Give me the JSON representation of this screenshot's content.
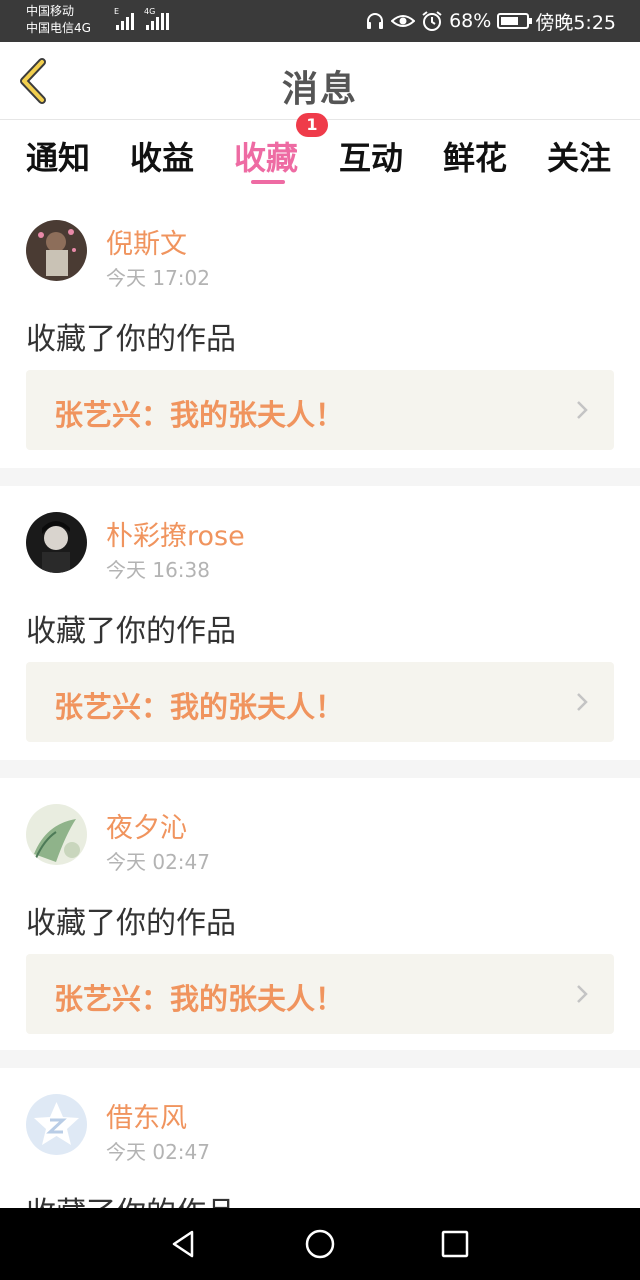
{
  "status_bar": {
    "carrier_1": "中国移动",
    "carrier_2": "中国电信4G",
    "signal_1_label": "E",
    "signal_2_label": "4G",
    "battery_text": "68%",
    "battery_level": 0.68,
    "time_text": "傍晚5:25",
    "icons": [
      "headset-icon",
      "eye-icon",
      "alarm-icon",
      "battery-icon"
    ]
  },
  "header": {
    "title": "消息",
    "back_icon": "chevron-left-icon"
  },
  "tabs": [
    {
      "label": "通知",
      "active": false
    },
    {
      "label": "收益",
      "active": false
    },
    {
      "label": "收藏",
      "active": true,
      "badge": "1"
    },
    {
      "label": "互动",
      "active": false
    },
    {
      "label": "鲜花",
      "active": false
    },
    {
      "label": "关注",
      "active": false
    }
  ],
  "colors": {
    "accent_pink": "#ee6ba3",
    "name_orange": "#f0945e",
    "badge_red": "#ef3b4a",
    "work_box_bg": "#f5f4ee"
  },
  "messages": [
    {
      "name": "倪斯文",
      "time": "今天  17:02",
      "action": "收藏了你的作品",
      "work_title": "张艺兴：我的张夫人！"
    },
    {
      "name": "朴彩撩rose",
      "time": "今天  16:38",
      "action": "收藏了你的作品",
      "work_title": "张艺兴：我的张夫人！"
    },
    {
      "name": "夜夕沁",
      "time": "今天  02:47",
      "action": "收藏了你的作品",
      "work_title": "张艺兴：我的张夫人！"
    },
    {
      "name": "借东风",
      "time": "今天  02:47",
      "action": "收藏了你的作品"
    }
  ],
  "nav_bar": {
    "icons": [
      "back-triangle-icon",
      "home-circle-icon",
      "recents-square-icon"
    ]
  }
}
